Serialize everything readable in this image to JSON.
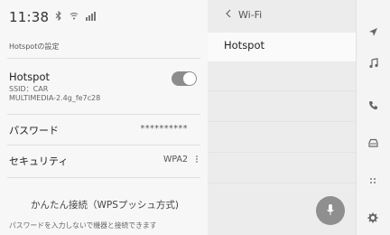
{
  "status_bar": {
    "time": "11:38",
    "icons": [
      "bluetooth-icon",
      "wifi-signal-icon",
      "signal-bars-icon"
    ]
  },
  "left": {
    "section_title": "Hotspotの設定",
    "hotspot": {
      "name": "Hotspot",
      "ssid_label": "SSID：CAR",
      "ssid_value": "MULTIMEDIA-2.4g_fe7c28",
      "toggle_on": true
    },
    "password": {
      "label": "パスワード",
      "value": "**********"
    },
    "security": {
      "label": "セキュリティ",
      "value": "WPA2"
    },
    "wps": {
      "label": "かんたん接続（WPSプッシュ方式)",
      "note": "パスワードを入力しないで機器と接続できます"
    }
  },
  "right": {
    "back_label": "Wi-Fi",
    "selected_item": "Hotspot"
  },
  "rail": {
    "icons": [
      "navigation-icon",
      "music-note-icon",
      "phone-icon",
      "car-icon",
      "apps-icon",
      "settings-gear-icon"
    ]
  },
  "colors": {
    "toggle_on": "#8c8c8c",
    "mic_button": "#8f8f8f",
    "left_bg": "#f7f7f7",
    "right_bg": "#ececec"
  }
}
